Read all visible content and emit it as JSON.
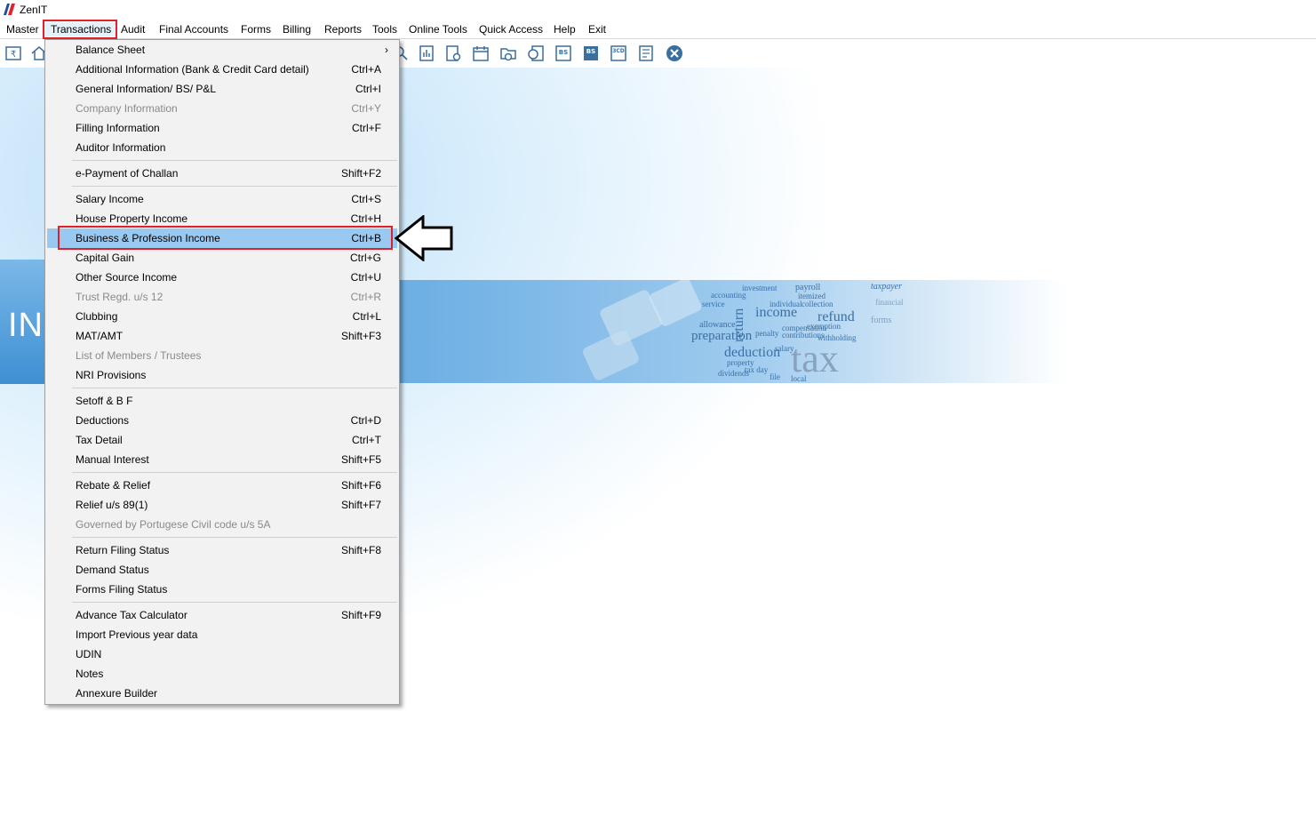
{
  "app": {
    "title": "ZenIT"
  },
  "menubar": {
    "items": [
      "Master",
      "Transactions",
      "Audit",
      "Final Accounts",
      "Forms",
      "Billing",
      "Reports",
      "Tools",
      "Online Tools",
      "Quick Access",
      "Help",
      "Exit"
    ]
  },
  "banner": {
    "text": "INC"
  },
  "dropdown": {
    "items": [
      {
        "label": "Balance Sheet",
        "shortcut": "",
        "submenu": true
      },
      {
        "label": "Additional Information (Bank & Credit Card detail)",
        "shortcut": "Ctrl+A"
      },
      {
        "label": "General Information/ BS/ P&L",
        "shortcut": "Ctrl+I"
      },
      {
        "label": "Company Information",
        "shortcut": "Ctrl+Y",
        "disabled": true
      },
      {
        "label": "Filling Information",
        "shortcut": "Ctrl+F"
      },
      {
        "label": "Auditor Information",
        "shortcut": ""
      },
      {
        "label": "e-Payment of Challan",
        "shortcut": "Shift+F2"
      },
      {
        "label": "Salary Income",
        "shortcut": "Ctrl+S"
      },
      {
        "label": "House Property Income",
        "shortcut": "Ctrl+H"
      },
      {
        "label": "Business & Profession Income",
        "shortcut": "Ctrl+B",
        "highlight": true
      },
      {
        "label": "Capital Gain",
        "shortcut": "Ctrl+G"
      },
      {
        "label": "Other Source Income",
        "shortcut": "Ctrl+U"
      },
      {
        "label": "Trust Regd. u/s 12",
        "shortcut": "Ctrl+R",
        "disabled": true
      },
      {
        "label": "Clubbing",
        "shortcut": "Ctrl+L"
      },
      {
        "label": "MAT/AMT",
        "shortcut": "Shift+F3"
      },
      {
        "label": "List of Members / Trustees",
        "shortcut": "",
        "disabled": true
      },
      {
        "label": "NRI Provisions",
        "shortcut": ""
      },
      {
        "label": "Setoff & B F",
        "shortcut": ""
      },
      {
        "label": "Deductions",
        "shortcut": "Ctrl+D"
      },
      {
        "label": "Tax Detail",
        "shortcut": "Ctrl+T"
      },
      {
        "label": "Manual Interest",
        "shortcut": "Shift+F5"
      },
      {
        "label": "Rebate & Relief",
        "shortcut": "Shift+F6"
      },
      {
        "label": "Relief u/s 89(1)",
        "shortcut": "Shift+F7"
      },
      {
        "label": "Governed by Portugese Civil code u/s 5A",
        "shortcut": "",
        "disabled": true
      },
      {
        "label": "Return Filing Status",
        "shortcut": "Shift+F8"
      },
      {
        "label": "Demand Status",
        "shortcut": ""
      },
      {
        "label": "Forms Filing Status",
        "shortcut": ""
      },
      {
        "label": "Advance Tax Calculator",
        "shortcut": "Shift+F9"
      },
      {
        "label": "Import Previous year data",
        "shortcut": ""
      },
      {
        "label": "UDIN",
        "shortcut": ""
      },
      {
        "label": "Notes",
        "shortcut": ""
      },
      {
        "label": "Annexure Builder",
        "shortcut": ""
      }
    ]
  },
  "toolbar": {
    "icons": [
      "rupee-book-icon",
      "home-icon",
      "search-icon",
      "report-icon",
      "user-doc-icon",
      "calendar-icon",
      "folder-add-icon",
      "chat-doc-icon",
      "bs-icon",
      "bs-sch-icon",
      "3cd-icon",
      "form-icon",
      "close-icon"
    ],
    "labels": {
      "bs": "BS",
      "bs_sch": "BS",
      "cd": "3CD"
    }
  },
  "wordcloud": [
    "payroll",
    "taxpayer",
    "investment",
    "itemized",
    "accounting",
    "collection",
    "service",
    "individual",
    "income",
    "refund",
    "return",
    "exemption",
    "allowance",
    "compensation",
    "preparation",
    "penalty",
    "contributions",
    "withholding",
    "deduction",
    "salary",
    "property",
    "tax day",
    "dividends",
    "file",
    "local",
    "tax",
    "forms",
    "financial"
  ],
  "colors": {
    "highlight": "#99c9f1",
    "annotation_red": "#e0202a",
    "disabled": "#8a8a8a"
  }
}
